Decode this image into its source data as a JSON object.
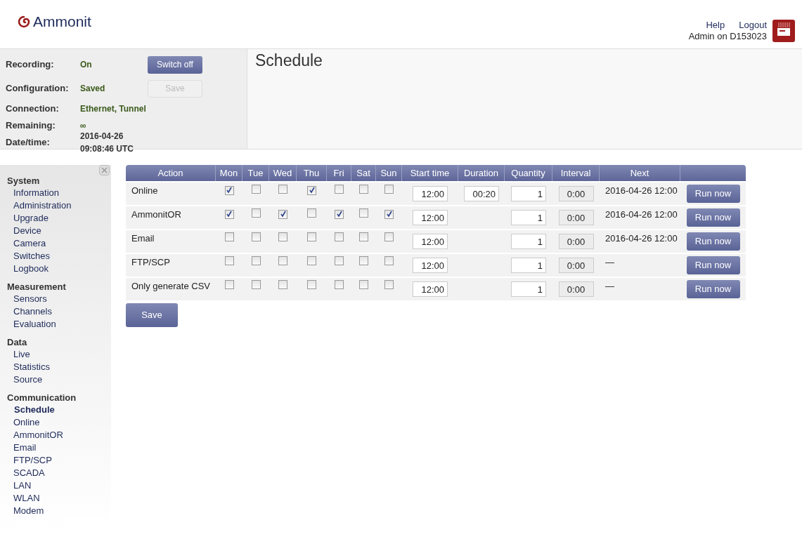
{
  "logo": "Ammonit",
  "header": {
    "links": [
      "Help",
      "Logout"
    ],
    "user": "Admin on D153023"
  },
  "status": [
    {
      "label": "Recording:",
      "value": "On",
      "button": {
        "label": "Switch off",
        "disabled": false
      }
    },
    {
      "label": "Configuration:",
      "value": "Saved",
      "button": {
        "label": "Save",
        "disabled": true
      }
    },
    {
      "label": "Connection:",
      "value": "Ethernet, Tunnel"
    },
    {
      "label": "Remaining:",
      "value": "∞"
    },
    {
      "label": "Date/time:",
      "value": "2016-04-26 09:08:46 UTC",
      "kind": "plain"
    }
  ],
  "page_title": "Schedule",
  "sidebar": {
    "groups": [
      {
        "title": "System",
        "items": [
          {
            "label": "Information",
            "selected": false
          },
          {
            "label": "Administration",
            "selected": false
          },
          {
            "label": "Upgrade",
            "selected": false
          },
          {
            "label": "Device",
            "selected": false
          },
          {
            "label": "Camera",
            "selected": false
          },
          {
            "label": "Switches",
            "selected": false
          },
          {
            "label": "Logbook",
            "selected": false
          }
        ]
      },
      {
        "title": "Measurement",
        "items": [
          {
            "label": "Sensors",
            "selected": false
          },
          {
            "label": "Channels",
            "selected": false
          },
          {
            "label": "Evaluation",
            "selected": false
          }
        ]
      },
      {
        "title": "Data",
        "items": [
          {
            "label": "Live",
            "selected": false
          },
          {
            "label": "Statistics",
            "selected": false
          },
          {
            "label": "Source",
            "selected": false
          }
        ]
      },
      {
        "title": "Communication",
        "items": [
          {
            "label": "Schedule",
            "selected": true
          },
          {
            "label": "Online",
            "selected": false
          },
          {
            "label": "AmmonitOR",
            "selected": false
          },
          {
            "label": "Email",
            "selected": false
          },
          {
            "label": "FTP/SCP",
            "selected": false
          },
          {
            "label": "SCADA",
            "selected": false
          },
          {
            "label": "LAN",
            "selected": false
          },
          {
            "label": "WLAN",
            "selected": false
          },
          {
            "label": "Modem",
            "selected": false
          }
        ]
      }
    ]
  },
  "table": {
    "columns": [
      "Action",
      "Mon",
      "Tue",
      "Wed",
      "Thu",
      "Fri",
      "Sat",
      "Sun",
      "Start time",
      "Duration",
      "Quantity",
      "Interval",
      "Next"
    ],
    "rows": [
      {
        "action": "Online",
        "days": [
          true,
          false,
          false,
          true,
          false,
          false,
          false
        ],
        "start_time": "12:00",
        "duration": "00:20",
        "quantity": "1",
        "interval": "0:00",
        "next": "2016-04-26 12:00",
        "button": "Run now"
      },
      {
        "action": "AmmonitOR",
        "days": [
          true,
          false,
          true,
          false,
          true,
          false,
          true
        ],
        "start_time": "12:00",
        "quantity": "1",
        "interval": "0:00",
        "next": "2016-04-26 12:00",
        "button": "Run now"
      },
      {
        "action": "Email",
        "days": [
          false,
          false,
          false,
          false,
          false,
          false,
          false
        ],
        "start_time": "12:00",
        "quantity": "1",
        "interval": "0:00",
        "next": "2016-04-26 12:00",
        "button": "Run now"
      },
      {
        "action": "FTP/SCP",
        "days": [
          false,
          false,
          false,
          false,
          false,
          false,
          false
        ],
        "start_time": "12:00",
        "quantity": "1",
        "interval": "0:00",
        "next": "—",
        "button": "Run now"
      },
      {
        "action": "Only generate CSV",
        "days": [
          false,
          false,
          false,
          false,
          false,
          false,
          false
        ],
        "start_time": "12:00",
        "quantity": "1",
        "interval": "0:00",
        "next": "—",
        "button": "Run now"
      }
    ]
  },
  "save_button": "Save"
}
